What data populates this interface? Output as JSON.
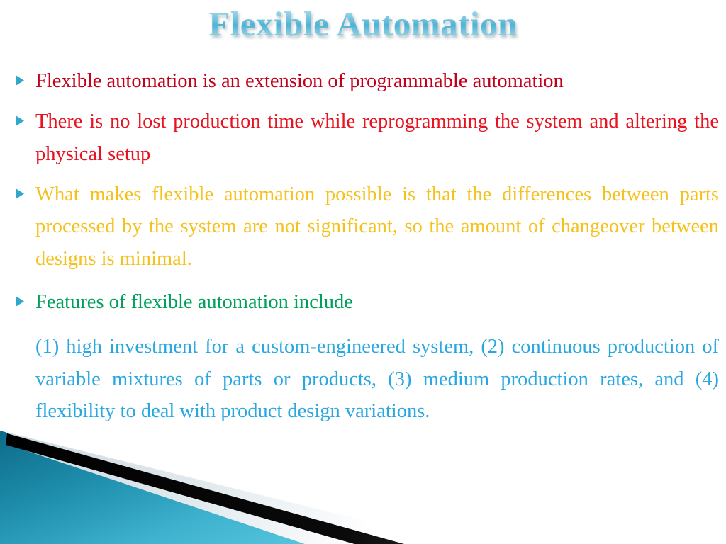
{
  "slide": {
    "title": "Flexible Automation",
    "title_color": "#6ec3dc",
    "background_color": "#ffffff",
    "bullet_marker_icon": "triangle-right-icon",
    "bullet_marker_color": "#31a8c9",
    "blocks": [
      {
        "kind": "bullet",
        "text": "Flexible automation is an extension of programmable automation",
        "color": "#c1001b"
      },
      {
        "kind": "bullet",
        "text": "There is no lost production time while reprogramming the system and altering the physical setup",
        "color": "#e81320"
      },
      {
        "kind": "bullet",
        "text": "What makes flexible automation possible is that the differences between parts processed by the system are not significant, so the amount of changeover between designs is minimal.",
        "color": "#f5c11c"
      },
      {
        "kind": "bullet",
        "text": "Features of flexible automation include",
        "color": "#00a05a"
      },
      {
        "kind": "paragraph",
        "text": "(1) high investment for a custom-engineered system, (2) continuous production of variable mixtures of parts or products, (3) medium production rates, and (4) flexibility to deal with product design variations.",
        "color": "#29a8e0"
      }
    ],
    "decoration": {
      "name": "diagonal-ribbon-decoration",
      "teal_dark": "#0f6e8c",
      "teal_light": "#4fc0dc",
      "black": "#000000",
      "light_gray": "#dfe7ec"
    }
  }
}
